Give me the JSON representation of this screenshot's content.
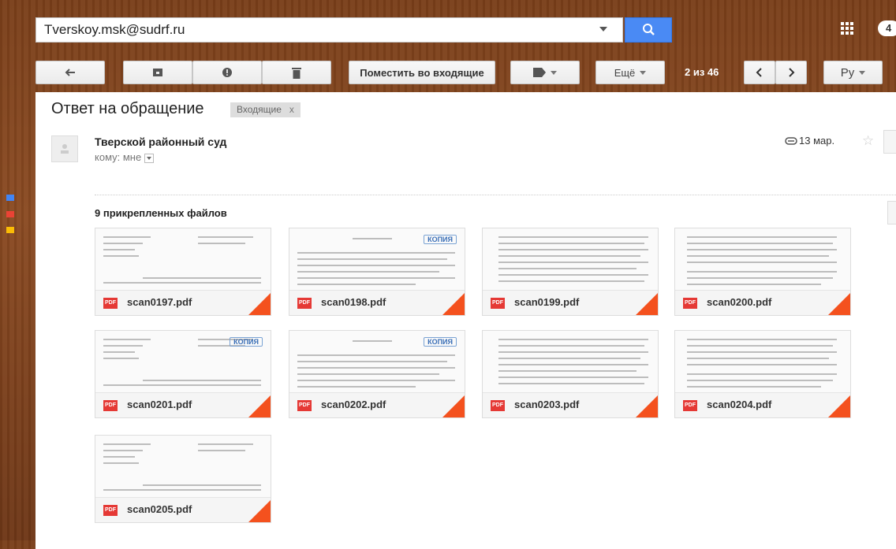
{
  "search": {
    "value": "Tverskoy.msk@sudrf.ru"
  },
  "header": {
    "notif_count": "4"
  },
  "toolbar": {
    "move_inbox": "Поместить во входящие",
    "more": "Ещё",
    "pager": "2 из 46",
    "lang": "Ру"
  },
  "message": {
    "subject": "Ответ на обращение",
    "label": "Входящие",
    "label_close": "x",
    "sender": "Тверской районный суд",
    "to_me": "кому: мне",
    "date": "13 мар.",
    "attachments_title": "9 прикрепленных файлов"
  },
  "attachments": [
    {
      "name": "scan0197.pdf",
      "stamp": ""
    },
    {
      "name": "scan0198.pdf",
      "stamp": "КОПИЯ"
    },
    {
      "name": "scan0199.pdf",
      "stamp": ""
    },
    {
      "name": "scan0200.pdf",
      "stamp": ""
    },
    {
      "name": "scan0201.pdf",
      "stamp": "КОПИЯ"
    },
    {
      "name": "scan0202.pdf",
      "stamp": "КОПИЯ"
    },
    {
      "name": "scan0203.pdf",
      "stamp": ""
    },
    {
      "name": "scan0204.pdf",
      "stamp": ""
    },
    {
      "name": "scan0205.pdf",
      "stamp": ""
    }
  ],
  "icons": {
    "back": "back-arrow-icon",
    "archive": "archive-icon",
    "spam": "spam-icon",
    "delete": "trash-icon",
    "label": "label-tag-icon",
    "search": "search-icon",
    "apps": "apps-grid-icon",
    "attachment": "paperclip-icon",
    "star": "star-icon",
    "pdf": "pdf-file-icon"
  },
  "colors": {
    "search_button": "#4a8af4",
    "pdf_red": "#e53935",
    "corner_orange": "#f4511e"
  }
}
